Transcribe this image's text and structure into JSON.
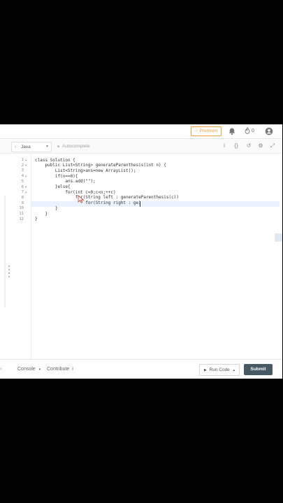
{
  "topbar": {
    "premium_label": "Premium",
    "streak_count": "0",
    "premium_color": "#f0a13a"
  },
  "toolbar": {
    "language": "Java",
    "autocomplete_label": "Autocomplete"
  },
  "editor": {
    "lines": [
      {
        "num": "1",
        "fold": "▾",
        "code": "class Solution {"
      },
      {
        "num": "2",
        "fold": "▾",
        "code": "    public List<String> generateParenthesis(int n) {"
      },
      {
        "num": "3",
        "fold": "",
        "code": "        List<String>ans=new ArrayList();"
      },
      {
        "num": "4",
        "fold": "▾",
        "code": "        if(n==0){"
      },
      {
        "num": "5",
        "fold": "",
        "code": "            ans.add(\"\");"
      },
      {
        "num": "6",
        "fold": "▾",
        "code": "        }else{"
      },
      {
        "num": "7",
        "fold": "▾",
        "code": "            for(int c=0;c<n;++c)"
      },
      {
        "num": "8",
        "fold": "",
        "code": "                for(String left : generateParenthesis(c))"
      },
      {
        "num": "9",
        "fold": "",
        "code": "                    for(String right : ge)"
      },
      {
        "num": "10",
        "fold": "",
        "code": "        }"
      },
      {
        "num": "11",
        "fold": "",
        "code": "    }"
      },
      {
        "num": "12",
        "fold": "",
        "code": "}"
      }
    ]
  },
  "bottombar": {
    "console_label": "Console",
    "contribute_label": "Contribute",
    "run_label": "Run Code",
    "submit_label": "Submit",
    "submit_color": "#455a64"
  }
}
